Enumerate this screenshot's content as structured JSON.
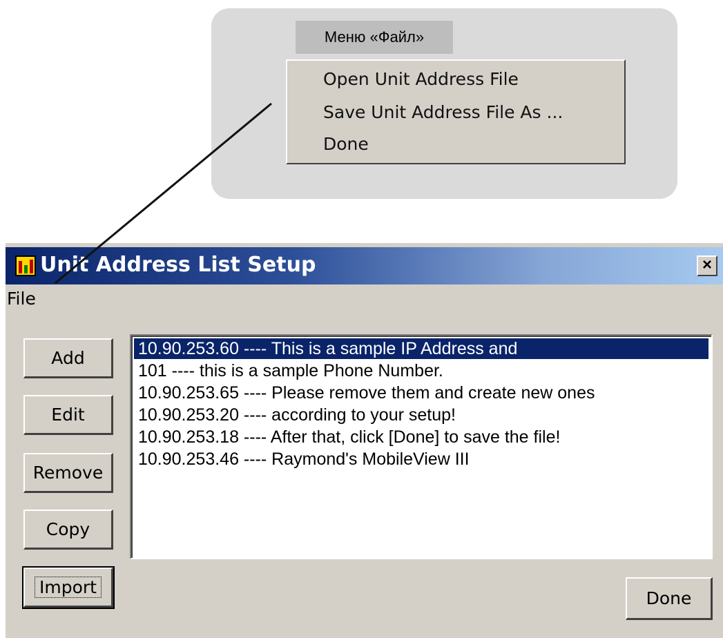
{
  "callout": {
    "label": "Меню «Файл»",
    "menu_items": [
      "Open Unit Address File",
      "Save Unit Address File As ...",
      "Done"
    ]
  },
  "window": {
    "title": "Unit Address List Setup",
    "close_label": "×",
    "menu": "File",
    "buttons": {
      "add": "Add",
      "edit": "Edit",
      "remove": "Remove",
      "copy": "Copy",
      "import": "Import",
      "done": "Done"
    },
    "list": [
      "10.90.253.60  ----  This is a  sample IP Address and",
      "101  ----  this is a sample Phone Number.",
      "10.90.253.65  ----  Please remove them and create new ones",
      "10.90.253.20  ----  according to your setup!",
      "10.90.253.18  ----  After that, click [Done] to save the file!",
      "10.90.253.46  ----  Raymond's MobileView III"
    ],
    "selected_index": 0
  },
  "colors": {
    "title_gradient_start": "#0a246a",
    "title_gradient_end": "#a6caf0",
    "selection": "#0a246a",
    "face": "#d4d0c8"
  }
}
